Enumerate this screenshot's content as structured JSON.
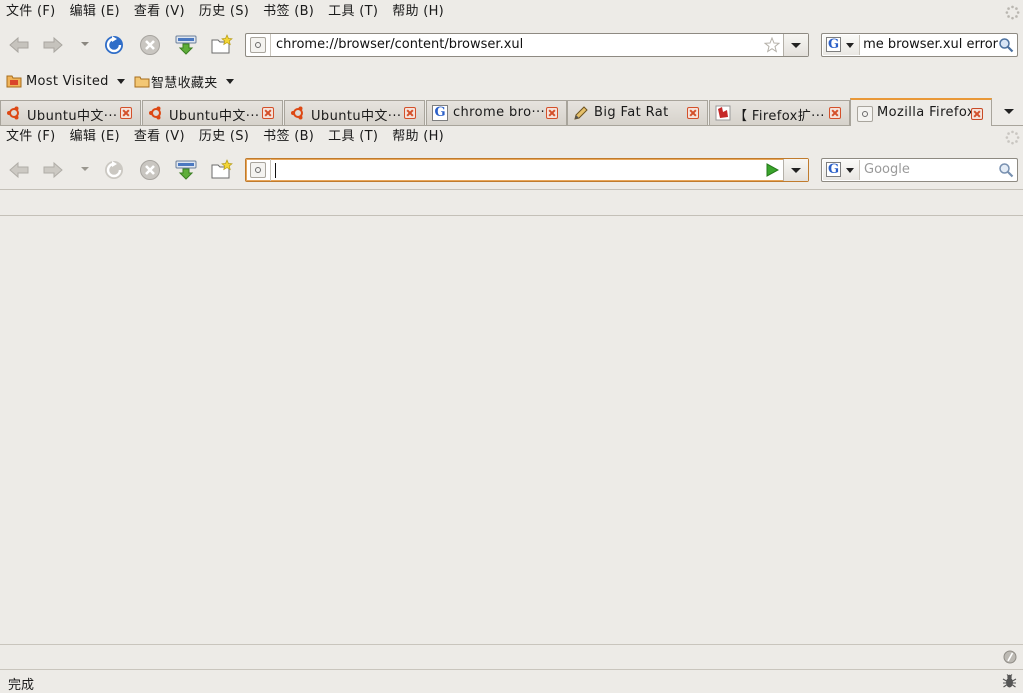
{
  "outer": {
    "menu": [
      "文件 (F)",
      "编辑 (E)",
      "查看 (V)",
      "历史 (S)",
      "书签 (B)",
      "工具 (T)",
      "帮助 (H)"
    ],
    "url": "chrome://browser/content/browser.xul",
    "search_value": "me browser.xul error"
  },
  "bookmarks": {
    "most_visited": "Most Visited",
    "smart_folder": "智慧收藏夹"
  },
  "tabs": [
    {
      "label": "Ubuntu中文···",
      "icon": "ubuntu-icon"
    },
    {
      "label": "Ubuntu中文···",
      "icon": "ubuntu-icon"
    },
    {
      "label": "Ubuntu中文···",
      "icon": "ubuntu-icon"
    },
    {
      "label": "chrome bro···",
      "icon": "google-icon"
    },
    {
      "label": "Big  Fat  Rat",
      "icon": "pencil-icon"
    },
    {
      "label": "【 Firefox扩···",
      "icon": "firefox-ext-icon"
    },
    {
      "label": "Mozilla Firefox",
      "icon": "page-icon",
      "active": true
    }
  ],
  "inner": {
    "menu": [
      "文件 (F)",
      "编辑 (E)",
      "查看 (V)",
      "历史 (S)",
      "书签 (B)",
      "工具 (T)",
      "帮助 (H)"
    ],
    "url": "",
    "search_placeholder": "Google"
  },
  "status": {
    "text": "完成"
  },
  "colors": {
    "accent_tab": "#e99838",
    "reload_blue": "#2f6dc8",
    "go_green": "#3aa52c",
    "close_tab_red": "#d4502a"
  }
}
